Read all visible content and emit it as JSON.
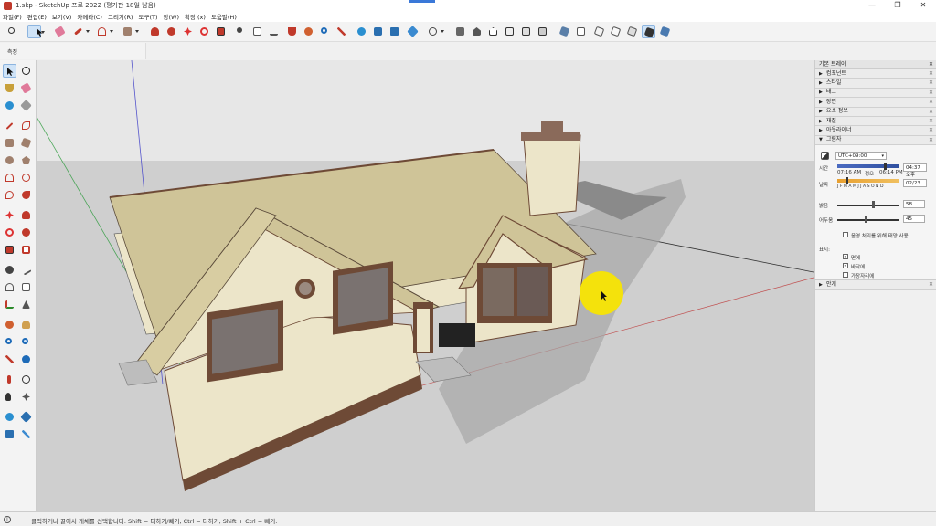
{
  "window": {
    "title": "1.skp - SketchUp 프로 2022 (평가판 18일 남음)",
    "minimize": "—",
    "maximize": "❐",
    "close": "✕"
  },
  "menu": [
    "파일(F)",
    "편집(E)",
    "보기(V)",
    "카메라(C)",
    "그리기(R)",
    "도구(T)",
    "창(W)",
    "확장 (x)",
    "도움말(H)"
  ],
  "measure_bar": {
    "label": "측정"
  },
  "tray": {
    "title": "기본 트레이",
    "close": "✕",
    "sections": [
      {
        "label": "컴포넌트",
        "state": "collapsed"
      },
      {
        "label": "스타일",
        "state": "collapsed"
      },
      {
        "label": "태그",
        "state": "collapsed"
      },
      {
        "label": "장면",
        "state": "collapsed"
      },
      {
        "label": "요소 정보",
        "state": "collapsed"
      },
      {
        "label": "재질",
        "state": "collapsed"
      },
      {
        "label": "아웃라이너",
        "state": "collapsed"
      },
      {
        "label": "그림자",
        "state": "expanded"
      }
    ],
    "shadows": {
      "timezone": "UTC+09:00",
      "time_label": "시간",
      "time_start": "07:16 AM",
      "noon": "정오",
      "time_end": "06:14 PM",
      "time_value": "04:37 오후",
      "date_label": "날짜",
      "months": "J F M A M J J A S O N D",
      "date_value": "02/23",
      "light_label": "밝음",
      "light_value": "58",
      "dark_label": "어두움",
      "dark_value": "45",
      "sun_for_shading": "음영 처리를 위해 태양 사용",
      "display_label": "표시:",
      "on_faces": "면에",
      "on_ground": "바닥에",
      "from_edges": "가장자리에",
      "time_progress": 0.78,
      "date_progress": 0.14,
      "light_progress": 0.58,
      "dark_progress": 0.45
    },
    "bottom_section": {
      "label": "안개",
      "state": "collapsed"
    }
  },
  "status_bar": {
    "info": "i",
    "text": "클릭하거나 끌어서 개체를 선택합니다. Shift = 더하기/빼기, Ctrl = 더하기, Shift + Ctrl = 빼기."
  },
  "colors": {
    "sky": "#e4e4e4",
    "ground": "#cfcfcf",
    "roof": "#cfc498",
    "wall": "#ece5c9",
    "trim": "#7d5c4b",
    "cursor_highlight": "#f4e20c"
  }
}
